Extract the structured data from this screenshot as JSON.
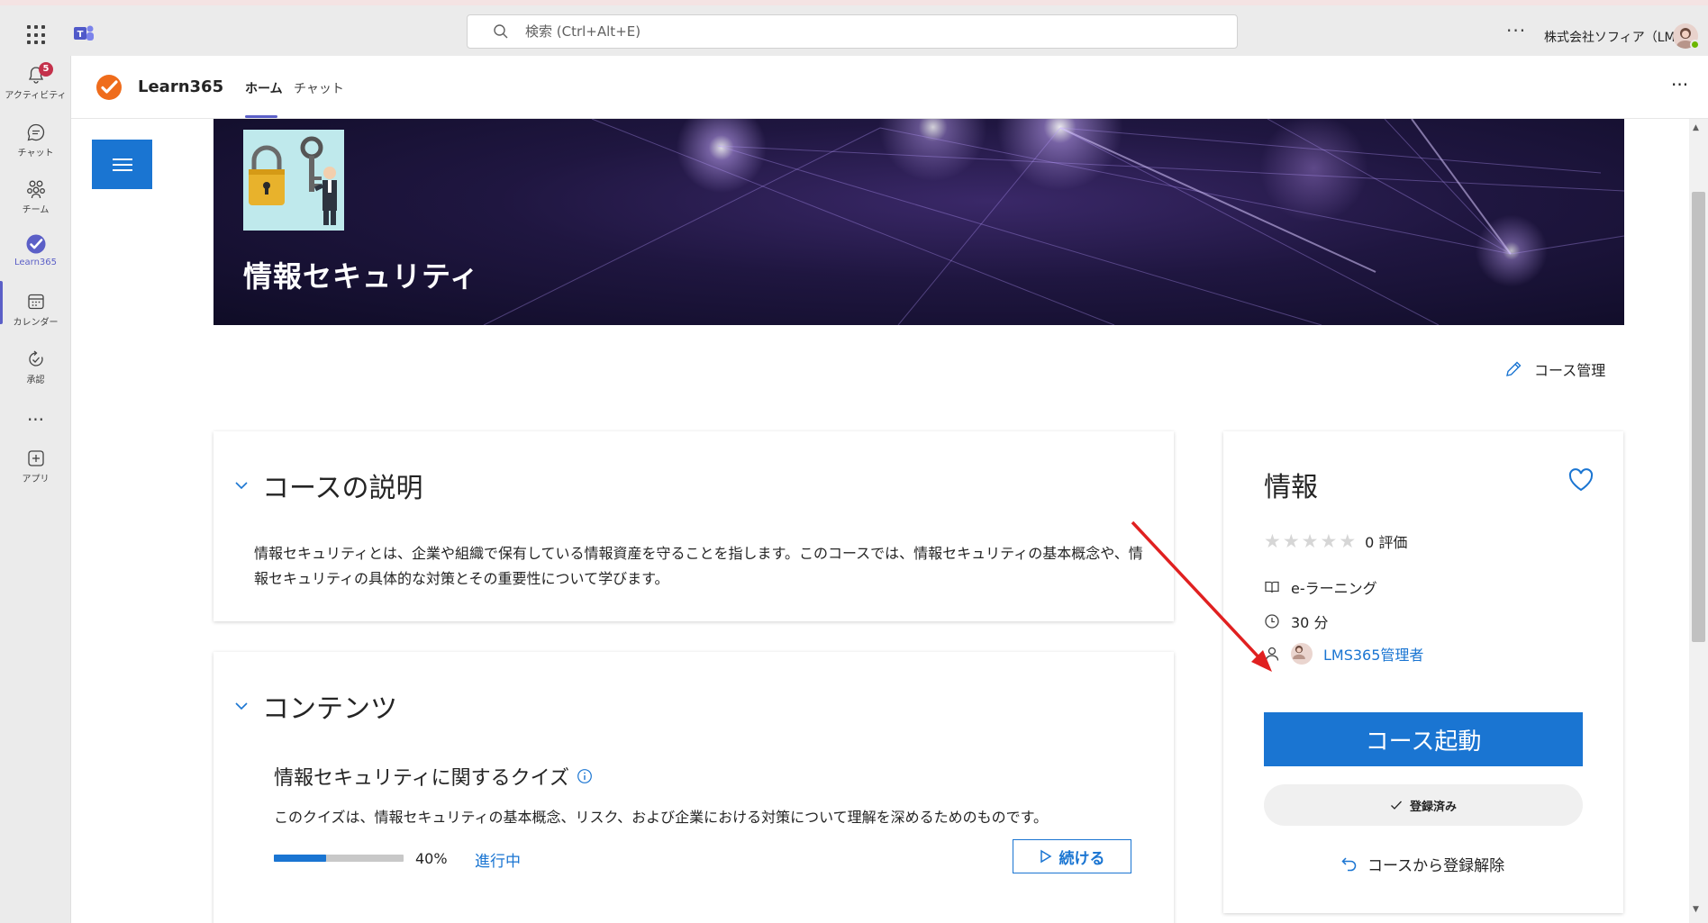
{
  "topbar": {
    "search_placeholder": "検索 (Ctrl+Alt+E)",
    "more": "···",
    "org_name": "株式会社ソフィア（LM..."
  },
  "rail": {
    "items": [
      {
        "label": "アクティビティ",
        "icon": "bell-icon",
        "badge": "5"
      },
      {
        "label": "チャット",
        "icon": "chat-icon"
      },
      {
        "label": "チーム",
        "icon": "teams-icon"
      },
      {
        "label": "Learn365",
        "icon": "learn365-icon"
      },
      {
        "label": "カレンダー",
        "icon": "calendar-icon"
      },
      {
        "label": "承認",
        "icon": "approvals-icon"
      },
      {
        "label": "",
        "icon": "more-icon"
      },
      {
        "label": "アプリ",
        "icon": "apps-add-icon"
      }
    ],
    "more": "···"
  },
  "app": {
    "name": "Learn365",
    "tabs": [
      {
        "label": "ホーム"
      },
      {
        "label": "チャット"
      }
    ],
    "more": "···",
    "accent": "#5b5fc7"
  },
  "course": {
    "title": "情報セキュリティ",
    "manage_label": "コース管理"
  },
  "description": {
    "heading": "コースの説明",
    "text": "情報セキュリティとは、企業や組織で保有している情報資産を守ることを指します。このコースでは、情報セキュリティの基本概念や、情報セキュリティの具体的な対策とその重要性について学びます。"
  },
  "contents": {
    "heading": "コンテンツ",
    "item": {
      "title": "情報セキュリティに関するクイズ",
      "description": "このクイズは、情報セキュリティの基本概念、リスク、および企業における対策について理解を深めるためのものです。",
      "progress": 40,
      "progress_label": "40%",
      "status": "進行中",
      "continue_label": "続ける"
    }
  },
  "info": {
    "heading": "情報",
    "rating_text": "0 評価",
    "rating_value": 0,
    "type": "e-ラーニング",
    "duration": "30 分",
    "owner": "LMS365管理者",
    "launch_label": "コース起動",
    "enrolled_label": "登録済み",
    "unenroll_label": "コースから登録解除"
  },
  "colors": {
    "primary": "#1a75d2",
    "annotation_arrow": "#e02020"
  }
}
